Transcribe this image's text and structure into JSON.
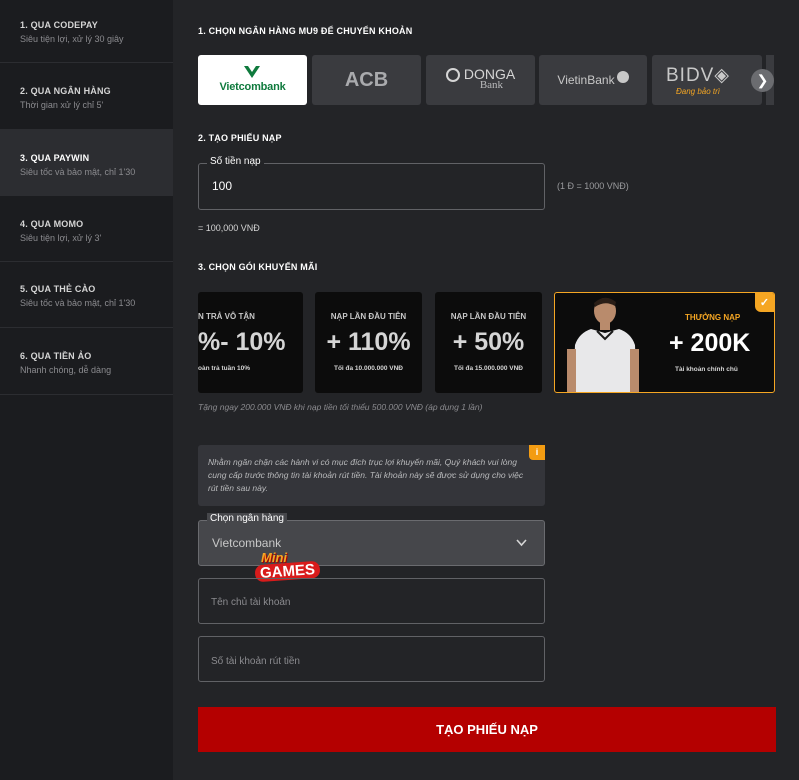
{
  "sidebar": {
    "items": [
      {
        "title": "1. QUA CODEPAY",
        "subtitle": "Siêu tiện lợi, xử lý 30 giây"
      },
      {
        "title": "2. QUA NGÂN HÀNG",
        "subtitle": "Thời gian xử lý chỉ 5'"
      },
      {
        "title": "3. QUA PAYWIN",
        "subtitle": "Siêu tốc và bảo mật, chỉ 1'30"
      },
      {
        "title": "4. QUA MOMO",
        "subtitle": "Siêu tiện lợi, xử lý 3'"
      },
      {
        "title": "5. QUA THẺ CÀO",
        "subtitle": "Siêu tốc và bảo mật, chỉ 1'30"
      },
      {
        "title": "6. QUA TIỀN ẢO",
        "subtitle": "Nhanh chóng, dễ dàng"
      }
    ],
    "active_index": 2
  },
  "bank_section": {
    "title": "1. CHỌN NGÂN HÀNG MU9 ĐỂ CHUYỂN KHOẢN",
    "banks": [
      {
        "name": "Vietcombank",
        "selected": true
      },
      {
        "name": "ACB"
      },
      {
        "name": "DONGA",
        "sub": "Bank"
      },
      {
        "name": "VietinBank"
      },
      {
        "name": "BIDV",
        "status": "Đang bảo trì"
      }
    ]
  },
  "deposit": {
    "title": "2. TẠO PHIẾU NẠP",
    "amount_label": "Số tiền nạp",
    "amount_value": "100",
    "rate_note": "(1 Đ = 1000 VNĐ)",
    "converted": "= 100,000 VNĐ"
  },
  "promo_section": {
    "title": "3. CHỌN GÓI KHUYẾN MÃI",
    "cards": [
      {
        "heading": "N TRẢ VÔ TẬN",
        "value": "%- 10%",
        "footer": "oàn trả tuần 10%"
      },
      {
        "heading": "NẠP LẦN ĐẦU TIÊN",
        "value": "+ 110%",
        "footer": "Tối đa 10.000.000 VNĐ"
      },
      {
        "heading": "NẠP LẦN ĐẦU TIÊN",
        "value": "+ 50%",
        "footer": "Tối đa 15.000.000 VNĐ"
      },
      {
        "heading": "THƯỞNG NẠP",
        "value": "+ 200K",
        "footer": "Tài khoản chính chủ",
        "selected": true
      }
    ],
    "note": "Tặng ngay 200.000 VNĐ khi nạp tiền tối thiểu 500.000 VNĐ (áp dụng 1 lần)"
  },
  "verify": {
    "info": "Nhằm ngăn chặn các hành vi có mục đích trục lợi khuyến mãi, Quý khách vui lòng cung cấp trước thông tin tài khoản rút tiền. Tài khoản này sẽ được sử dụng cho việc rút tiền sau này.",
    "bank_label": "Chọn ngân hàng",
    "bank_value": "Vietcombank",
    "holder_placeholder": "Tên chủ tài khoản",
    "account_placeholder": "Số tài khoản rút tiền",
    "watermark_top": "Mini",
    "watermark_bottom": "GAMES"
  },
  "submit_label": "TẠO PHIẾU NẠP",
  "colors": {
    "accent": "#b40000",
    "promo_gold": "#f5a623",
    "vcb_green": "#0f7a3d",
    "info_orange": "#f39c12"
  }
}
